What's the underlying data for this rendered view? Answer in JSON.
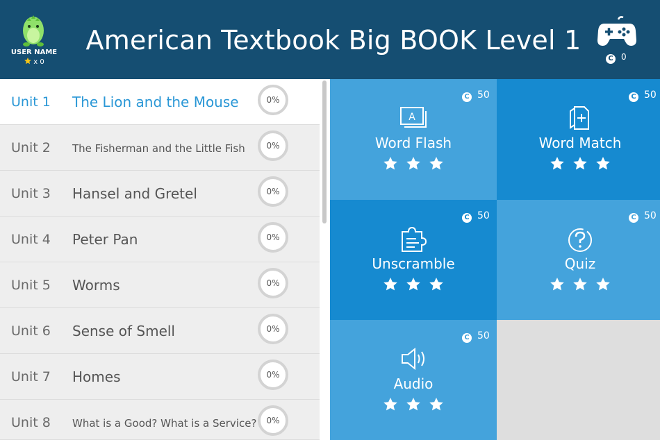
{
  "header": {
    "user_name": "USER NAME",
    "user_stars": "x 0",
    "title": "American Textbook Big BOOK Level 1",
    "coins": "0",
    "coin_symbol": "C"
  },
  "units": [
    {
      "num": "Unit 1",
      "title": "The Lion and the Mouse",
      "progress": "0%"
    },
    {
      "num": "Unit 2",
      "title": "The Fisherman and the Little Fish",
      "progress": "0%"
    },
    {
      "num": "Unit 3",
      "title": "Hansel and Gretel",
      "progress": "0%"
    },
    {
      "num": "Unit 4",
      "title": "Peter Pan",
      "progress": "0%"
    },
    {
      "num": "Unit 5",
      "title": "Worms",
      "progress": "0%"
    },
    {
      "num": "Unit 6",
      "title": "Sense of Smell",
      "progress": "0%"
    },
    {
      "num": "Unit 7",
      "title": "Homes",
      "progress": "0%"
    },
    {
      "num": "Unit 8",
      "title": "What is a Good? What is a Service?",
      "progress": "0%"
    }
  ],
  "activities": [
    {
      "label": "Word Flash",
      "coins": "50",
      "icon": "flashcard-icon"
    },
    {
      "label": "Word Match",
      "coins": "50",
      "icon": "card-plus-icon"
    },
    {
      "label": "Unscramble",
      "coins": "50",
      "icon": "puzzle-icon"
    },
    {
      "label": "Quiz",
      "coins": "50",
      "icon": "question-icon"
    },
    {
      "label": "Audio",
      "coins": "50",
      "icon": "speaker-icon"
    }
  ],
  "colors": {
    "header_bg": "#154e72",
    "tile_light": "#44a3dc",
    "tile_dark": "#168ad0",
    "selected_text": "#2a97d6",
    "avatar_green": "#8fe06a"
  }
}
